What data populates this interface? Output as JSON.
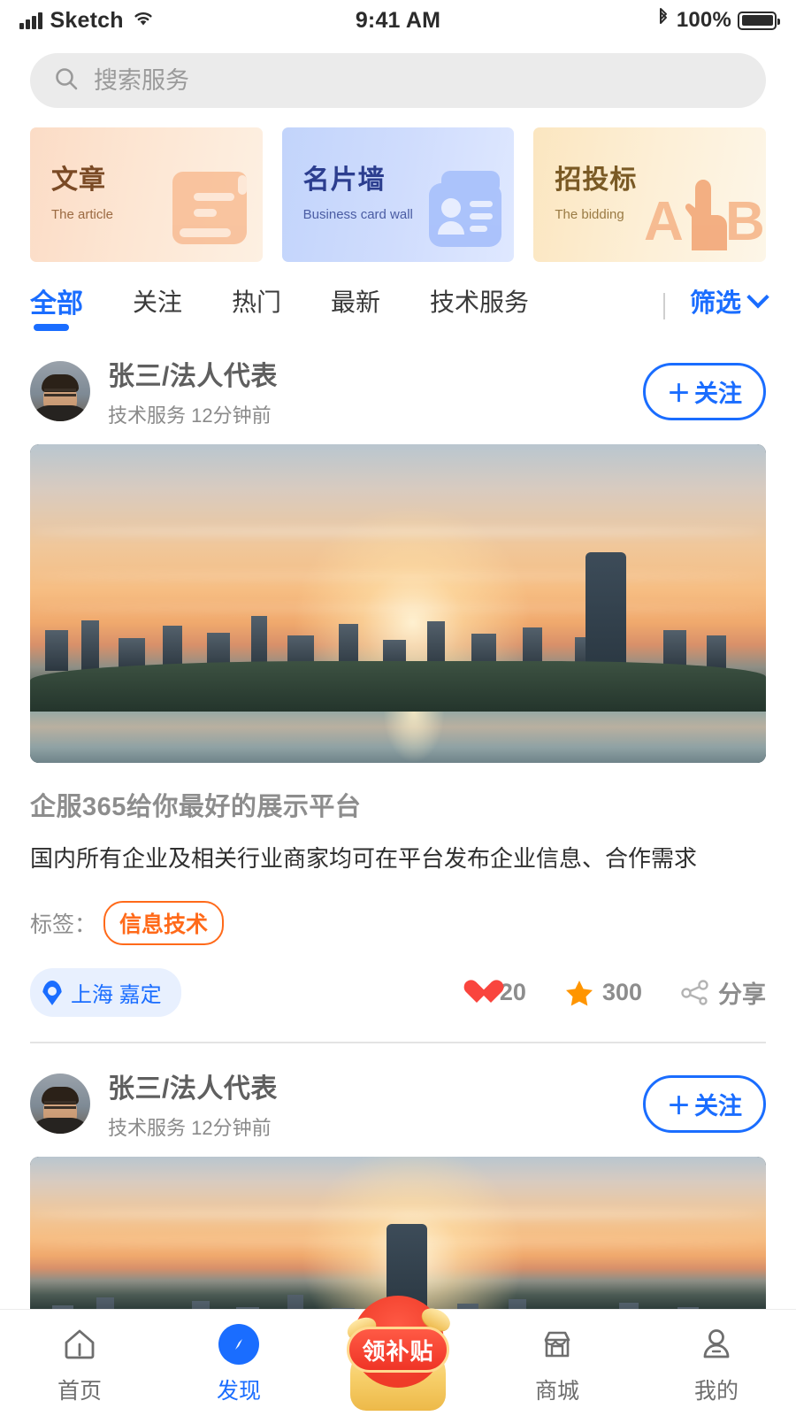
{
  "status_bar": {
    "carrier": "Sketch",
    "time": "9:41 AM",
    "battery_percent": "100%",
    "signal_icon": "signal-bars-icon",
    "wifi_icon": "wifi-icon",
    "bluetooth_icon": "bluetooth-icon",
    "battery_icon": "battery-full-icon"
  },
  "search": {
    "placeholder": "搜索服务",
    "value": "",
    "icon": "search-icon"
  },
  "banner_cards": [
    {
      "title": "文章",
      "subtitle": "The article",
      "art": "scroll-document-icon",
      "accent": "#f9d4b6"
    },
    {
      "title": "名片墙",
      "subtitle": "Business card wall",
      "art": "contact-card-icon",
      "accent": "#c2d4fb"
    },
    {
      "title": "招投标",
      "subtitle": "The bidding",
      "art": "ab-choice-hand-icon",
      "accent": "#fbe6c0"
    }
  ],
  "tabs": {
    "items": [
      {
        "label": "全部",
        "active": true
      },
      {
        "label": "关注",
        "active": false
      },
      {
        "label": "热门",
        "active": false
      },
      {
        "label": "最新",
        "active": false
      },
      {
        "label": "技术服务",
        "active": false
      }
    ],
    "filter_label": "筛选",
    "filter_icon": "chevron-down-icon"
  },
  "posts": [
    {
      "author": "张三/法人代表",
      "meta": "技术服务  12分钟前",
      "follow_label": "关注",
      "follow_plus": "＋",
      "title": "企服365给你最好的展示平台",
      "body": "国内所有企业及相关行业商家均可在平台发布企业信息、合作需求",
      "tag_label": "标签：",
      "tag": "信息技术",
      "location": "上海 嘉定",
      "location_icon": "location-pin-icon",
      "like_icon": "heart-icon",
      "likes": "20",
      "star_icon": "star-icon",
      "stars": "300",
      "share_icon": "share-icon",
      "share_label": "分享",
      "image_alt": "city-sunset-photo"
    },
    {
      "author": "张三/法人代表",
      "meta": "技术服务  12分钟前",
      "follow_label": "关注",
      "follow_plus": "＋",
      "image_alt": "city-sunset-photo"
    }
  ],
  "bottom_nav": {
    "items": [
      {
        "label": "首页",
        "icon": "home-icon",
        "active": false
      },
      {
        "label": "发现",
        "icon": "compass-icon",
        "active": true
      },
      {
        "label": "商城",
        "icon": "store-icon",
        "active": false
      },
      {
        "label": "我的",
        "icon": "person-icon",
        "active": false
      }
    ],
    "center_action": {
      "label": "领补贴",
      "icon": "coin-bag-icon"
    }
  },
  "colors": {
    "accent_blue": "#1a6dff",
    "tag_orange": "#ff6a1a",
    "like_red": "#f9453e",
    "star_orange": "#ff9500",
    "subsidy_red": "#ef3426"
  }
}
